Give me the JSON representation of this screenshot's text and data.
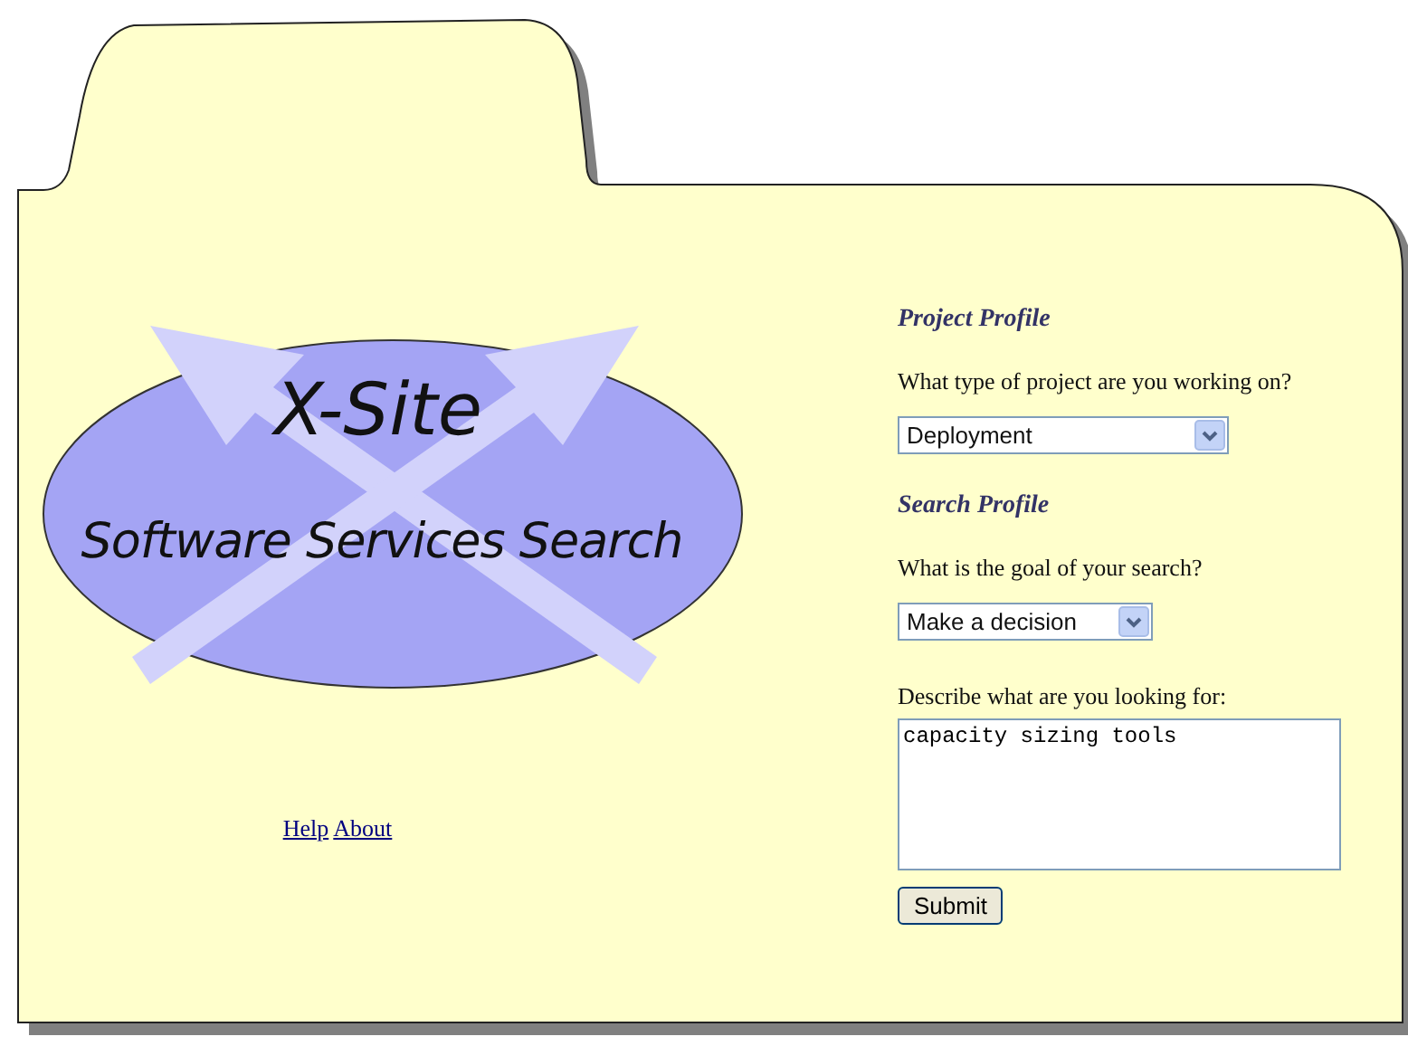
{
  "logo": {
    "title": "X-Site",
    "subtitle": "Software Services Search"
  },
  "links": [
    {
      "label": "Help"
    },
    {
      "label": "About"
    }
  ],
  "form": {
    "sections": [
      {
        "heading": "Project Profile",
        "question": "What type of project are you working on?",
        "dropdown": "Deployment"
      },
      {
        "heading": "Search Profile",
        "question": "What is the goal of your search?",
        "dropdown": "Make a decision"
      }
    ],
    "description": {
      "label": "Describe what are you looking for:",
      "value": "capacity sizing tools"
    },
    "submit": "Submit"
  }
}
